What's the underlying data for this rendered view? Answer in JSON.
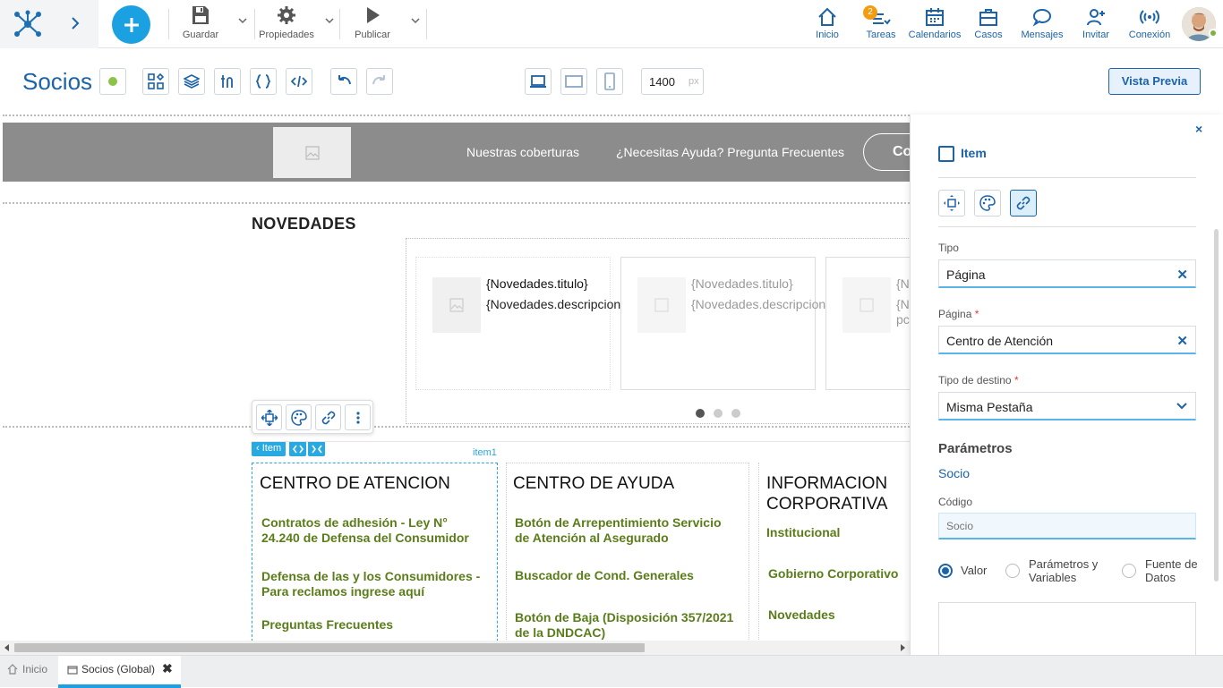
{
  "topbar": {
    "save_label": "Guardar",
    "properties_label": "Propiedades",
    "publish_label": "Publicar",
    "nav": [
      {
        "label": "Inicio",
        "icon": "home-icon"
      },
      {
        "label": "Tareas",
        "icon": "tasks-icon",
        "badge": "2"
      },
      {
        "label": "Calendarios",
        "icon": "calendar-icon"
      },
      {
        "label": "Casos",
        "icon": "briefcase-icon"
      },
      {
        "label": "Mensajes",
        "icon": "chat-icon"
      },
      {
        "label": "Invitar",
        "icon": "add-user-icon"
      },
      {
        "label": "Conexión",
        "icon": "broadcast-icon"
      }
    ]
  },
  "editor": {
    "page_title": "Socios",
    "width_value": "1400",
    "width_unit": "px",
    "preview_label": "Vista Previa"
  },
  "canvas": {
    "header_nav": [
      "Nuestras coberturas",
      "¿Necesitas Ayuda? Pregunta Frecuentes"
    ],
    "header_button": "Co",
    "novedades_title": "NOVEDADES",
    "cards": [
      {
        "title": "{Novedades.titulo}",
        "desc": "{Novedades.descripcion}"
      },
      {
        "title": "{Novedades.titulo}",
        "desc": "{Novedades.descripcion}"
      },
      {
        "title": "{N",
        "desc": "{N pc"
      }
    ],
    "breadcrumb_item": "Item",
    "item_label": "item1",
    "columns": [
      {
        "title": "CENTRO DE ATENCION",
        "links": [
          "Contratos de adhesión - Ley N° 24.240 de Defensa del Consumidor",
          "Defensa de las y los Consumidores - Para reclamos ingrese aquí",
          "Preguntas Frecuentes"
        ]
      },
      {
        "title": "CENTRO DE AYUDA",
        "links": [
          "Botón de Arrepentimiento Servicio de Atención al Asegurado",
          "Buscador de Cond. Generales",
          "Botón de Baja (Disposición 357/2021 de la DNDCAC)"
        ]
      },
      {
        "title": "INFORMACION CORPORATIVA",
        "links": [
          "Institucional",
          "Gobierno Corporativo",
          "Novedades"
        ]
      }
    ]
  },
  "panel": {
    "title": "Item",
    "tipo_label": "Tipo",
    "tipo_value": "Página",
    "pagina_label": "Página",
    "pagina_value": "Centro de Atención",
    "destino_label": "Tipo de destino",
    "destino_value": "Misma Pestaña",
    "params_title": "Parámetros",
    "param_name": "Socio",
    "codigo_label": "Código",
    "codigo_placeholder": "Socio",
    "radio_valor": "Valor",
    "radio_params": "Parámetros y Variables",
    "radio_fuente": "Fuente de Datos",
    "required_mark": "*"
  },
  "bottom": {
    "tab_home": "Inicio",
    "tab_active": "Socios (Global)"
  },
  "colors": {
    "accent": "#1ba1e2",
    "brand_blue": "#1c63a8",
    "link_green": "#5a7d1a",
    "header_gray": "#8c8c8c"
  }
}
